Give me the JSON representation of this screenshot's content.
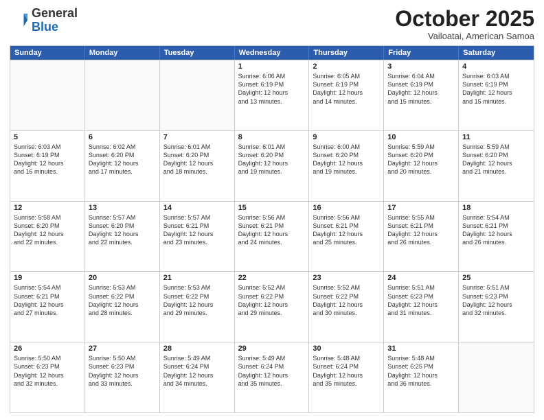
{
  "header": {
    "logo_general": "General",
    "logo_blue": "Blue",
    "month_title": "October 2025",
    "subtitle": "Vailoatai, American Samoa"
  },
  "days_of_week": [
    "Sunday",
    "Monday",
    "Tuesday",
    "Wednesday",
    "Thursday",
    "Friday",
    "Saturday"
  ],
  "rows": [
    [
      {
        "day": "",
        "text": ""
      },
      {
        "day": "",
        "text": ""
      },
      {
        "day": "",
        "text": ""
      },
      {
        "day": "1",
        "text": "Sunrise: 6:06 AM\nSunset: 6:19 PM\nDaylight: 12 hours\nand 13 minutes."
      },
      {
        "day": "2",
        "text": "Sunrise: 6:05 AM\nSunset: 6:19 PM\nDaylight: 12 hours\nand 14 minutes."
      },
      {
        "day": "3",
        "text": "Sunrise: 6:04 AM\nSunset: 6:19 PM\nDaylight: 12 hours\nand 15 minutes."
      },
      {
        "day": "4",
        "text": "Sunrise: 6:03 AM\nSunset: 6:19 PM\nDaylight: 12 hours\nand 15 minutes."
      }
    ],
    [
      {
        "day": "5",
        "text": "Sunrise: 6:03 AM\nSunset: 6:19 PM\nDaylight: 12 hours\nand 16 minutes."
      },
      {
        "day": "6",
        "text": "Sunrise: 6:02 AM\nSunset: 6:20 PM\nDaylight: 12 hours\nand 17 minutes."
      },
      {
        "day": "7",
        "text": "Sunrise: 6:01 AM\nSunset: 6:20 PM\nDaylight: 12 hours\nand 18 minutes."
      },
      {
        "day": "8",
        "text": "Sunrise: 6:01 AM\nSunset: 6:20 PM\nDaylight: 12 hours\nand 19 minutes."
      },
      {
        "day": "9",
        "text": "Sunrise: 6:00 AM\nSunset: 6:20 PM\nDaylight: 12 hours\nand 19 minutes."
      },
      {
        "day": "10",
        "text": "Sunrise: 5:59 AM\nSunset: 6:20 PM\nDaylight: 12 hours\nand 20 minutes."
      },
      {
        "day": "11",
        "text": "Sunrise: 5:59 AM\nSunset: 6:20 PM\nDaylight: 12 hours\nand 21 minutes."
      }
    ],
    [
      {
        "day": "12",
        "text": "Sunrise: 5:58 AM\nSunset: 6:20 PM\nDaylight: 12 hours\nand 22 minutes."
      },
      {
        "day": "13",
        "text": "Sunrise: 5:57 AM\nSunset: 6:20 PM\nDaylight: 12 hours\nand 22 minutes."
      },
      {
        "day": "14",
        "text": "Sunrise: 5:57 AM\nSunset: 6:21 PM\nDaylight: 12 hours\nand 23 minutes."
      },
      {
        "day": "15",
        "text": "Sunrise: 5:56 AM\nSunset: 6:21 PM\nDaylight: 12 hours\nand 24 minutes."
      },
      {
        "day": "16",
        "text": "Sunrise: 5:56 AM\nSunset: 6:21 PM\nDaylight: 12 hours\nand 25 minutes."
      },
      {
        "day": "17",
        "text": "Sunrise: 5:55 AM\nSunset: 6:21 PM\nDaylight: 12 hours\nand 26 minutes."
      },
      {
        "day": "18",
        "text": "Sunrise: 5:54 AM\nSunset: 6:21 PM\nDaylight: 12 hours\nand 26 minutes."
      }
    ],
    [
      {
        "day": "19",
        "text": "Sunrise: 5:54 AM\nSunset: 6:21 PM\nDaylight: 12 hours\nand 27 minutes."
      },
      {
        "day": "20",
        "text": "Sunrise: 5:53 AM\nSunset: 6:22 PM\nDaylight: 12 hours\nand 28 minutes."
      },
      {
        "day": "21",
        "text": "Sunrise: 5:53 AM\nSunset: 6:22 PM\nDaylight: 12 hours\nand 29 minutes."
      },
      {
        "day": "22",
        "text": "Sunrise: 5:52 AM\nSunset: 6:22 PM\nDaylight: 12 hours\nand 29 minutes."
      },
      {
        "day": "23",
        "text": "Sunrise: 5:52 AM\nSunset: 6:22 PM\nDaylight: 12 hours\nand 30 minutes."
      },
      {
        "day": "24",
        "text": "Sunrise: 5:51 AM\nSunset: 6:23 PM\nDaylight: 12 hours\nand 31 minutes."
      },
      {
        "day": "25",
        "text": "Sunrise: 5:51 AM\nSunset: 6:23 PM\nDaylight: 12 hours\nand 32 minutes."
      }
    ],
    [
      {
        "day": "26",
        "text": "Sunrise: 5:50 AM\nSunset: 6:23 PM\nDaylight: 12 hours\nand 32 minutes."
      },
      {
        "day": "27",
        "text": "Sunrise: 5:50 AM\nSunset: 6:23 PM\nDaylight: 12 hours\nand 33 minutes."
      },
      {
        "day": "28",
        "text": "Sunrise: 5:49 AM\nSunset: 6:24 PM\nDaylight: 12 hours\nand 34 minutes."
      },
      {
        "day": "29",
        "text": "Sunrise: 5:49 AM\nSunset: 6:24 PM\nDaylight: 12 hours\nand 35 minutes."
      },
      {
        "day": "30",
        "text": "Sunrise: 5:48 AM\nSunset: 6:24 PM\nDaylight: 12 hours\nand 35 minutes."
      },
      {
        "day": "31",
        "text": "Sunrise: 5:48 AM\nSunset: 6:25 PM\nDaylight: 12 hours\nand 36 minutes."
      },
      {
        "day": "",
        "text": ""
      }
    ]
  ]
}
